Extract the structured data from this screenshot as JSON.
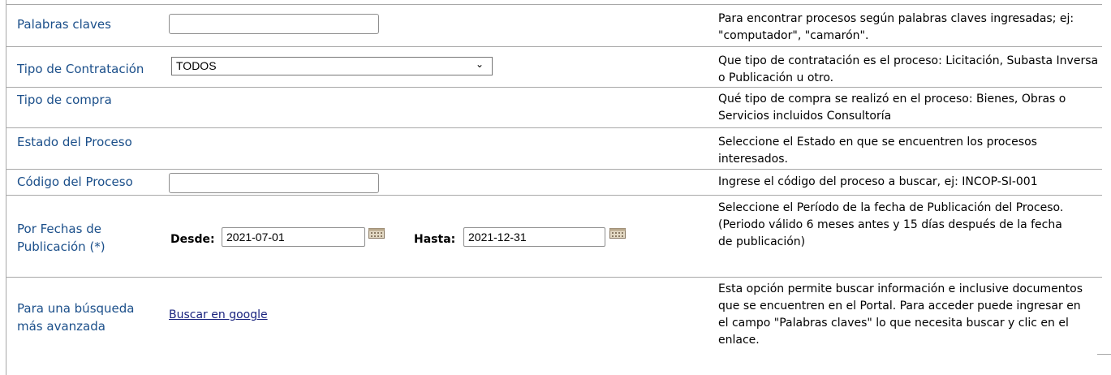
{
  "rows": {
    "keywords": {
      "label": "Palabras claves",
      "value": "",
      "desc": "Para encontrar procesos según palabras claves ingresadas; ej: \"computador\", \"camarón\"."
    },
    "contract_type": {
      "label": "Tipo de Contratación",
      "selected": "TODOS",
      "desc": "Que tipo de contratación es el proceso: Licitación, Subasta Inversa o Publicación u otro."
    },
    "purchase_type": {
      "label": "Tipo de compra",
      "desc": "Qué tipo de compra se realizó en el proceso: Bienes, Obras o Servicios incluidos Consultoría"
    },
    "process_state": {
      "label": "Estado del Proceso",
      "desc": "Seleccione el Estado en que se encuentren los procesos interesados."
    },
    "process_code": {
      "label": "Código del Proceso",
      "value": "",
      "desc": "Ingrese el código del proceso a buscar, ej: INCOP-SI-001"
    },
    "dates": {
      "label": "Por Fechas de Publicación (*)",
      "from_label": "Desde:",
      "from_value": "2021-07-01",
      "to_label": "Hasta:",
      "to_value": "2021-12-31",
      "desc": "Seleccione el Período de la fecha de Publicación del Proceso.",
      "desc_note": "(Periodo válido 6 meses antes y 15 días después de la fecha de publicación)"
    },
    "advanced": {
      "label": "Para una búsqueda más avanzada",
      "link": "Buscar en google",
      "desc": "Esta opción permite buscar información e inclusive documentos que se encuentren en el Portal. Para acceder puede ingresar en el campo \"Palabras claves\" lo que necesita buscar y clic en el enlace."
    }
  },
  "icons": {
    "calendar": "calendar-icon",
    "dropdown": "chevron-down-icon"
  },
  "colors": {
    "label": "#1b4f8a",
    "link": "#1a237e",
    "border": "#a8a8a8"
  }
}
